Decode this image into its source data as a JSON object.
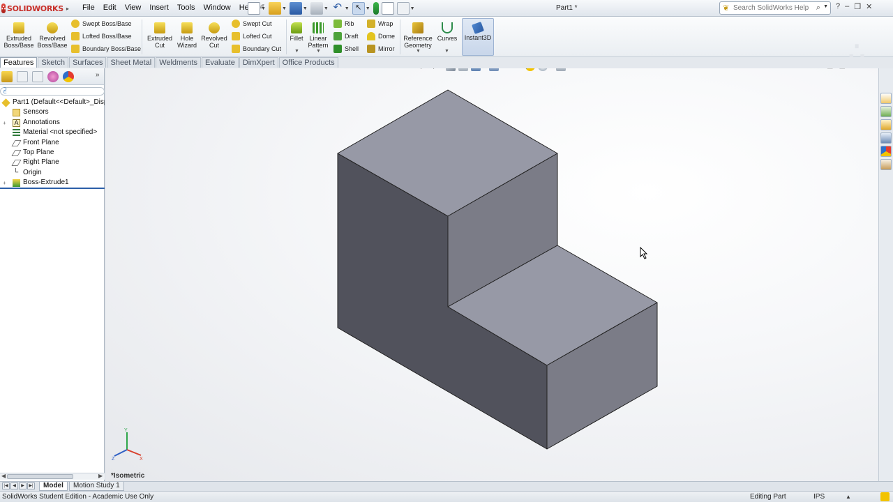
{
  "app": {
    "logo_text": "SOLIDWORKS",
    "document_title": "Part1 *",
    "menu": [
      "File",
      "Edit",
      "View",
      "Insert",
      "Tools",
      "Window",
      "Help"
    ],
    "help_search_placeholder": "Search SolidWorks Help"
  },
  "command_manager": {
    "extruded_boss": "Extruded Boss/Base",
    "revolved_boss": "Revolved Boss/Base",
    "swept_boss": "Swept Boss/Base",
    "lofted_boss": "Lofted Boss/Base",
    "boundary_boss": "Boundary Boss/Base",
    "extruded_cut": "Extruded Cut",
    "hole_wizard": "Hole Wizard",
    "revolved_cut": "Revolved Cut",
    "swept_cut": "Swept Cut",
    "lofted_cut": "Lofted Cut",
    "boundary_cut": "Boundary Cut",
    "fillet": "Fillet",
    "linear_pattern": "Linear Pattern",
    "rib": "Rib",
    "draft": "Draft",
    "shell": "Shell",
    "wrap": "Wrap",
    "dome": "Dome",
    "mirror": "Mirror",
    "reference_geometry": "Reference Geometry",
    "curves": "Curves",
    "instant3d": "Instant3D"
  },
  "tabs": [
    "Features",
    "Sketch",
    "Surfaces",
    "Sheet Metal",
    "Weldments",
    "Evaluate",
    "DimXpert",
    "Office Products"
  ],
  "feature_tree": {
    "root": "Part1  (Default<<Default>_Disp",
    "items": [
      "Sensors",
      "Annotations",
      "Material <not specified>",
      "Front Plane",
      "Top Plane",
      "Right Plane",
      "Origin",
      "Boss-Extrude1"
    ]
  },
  "viewport": {
    "view_label": "*Isometric"
  },
  "bottom_tabs": [
    "Model",
    "Motion Study 1"
  ],
  "status": {
    "edition": "SolidWorks Student Edition - Academic Use Only",
    "mode": "Editing Part",
    "units": "IPS"
  },
  "colors": {
    "face_top": "#9799a6",
    "face_left": "#51525c",
    "face_front": "#7b7c87",
    "edge": "#222222",
    "accent": "#2c5fa8"
  }
}
